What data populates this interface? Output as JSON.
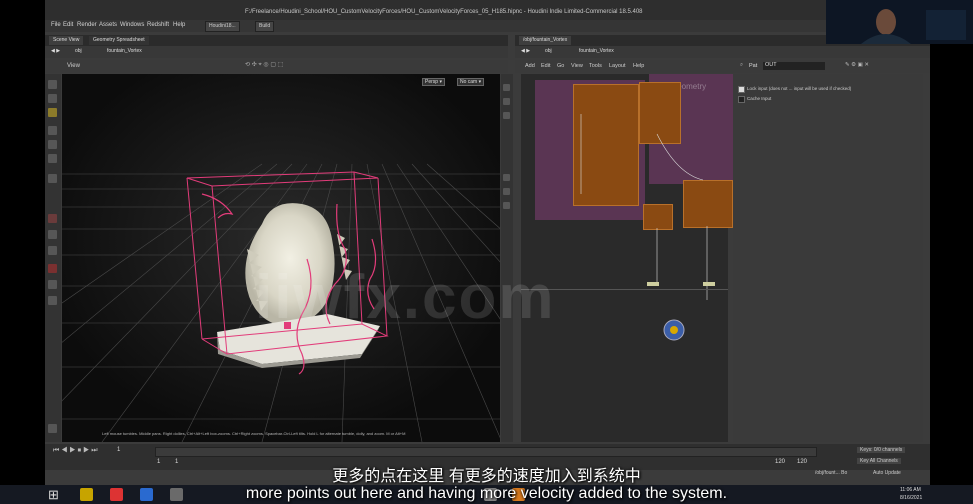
{
  "window": {
    "title": "F:/Freelance/Houdini_School/HOU_CustomVelocityForces/HOU_CustomVelocityForces_05_H185.hipnc - Houdini Indie Limited-Commercial 18.5.408"
  },
  "menu": [
    "File",
    "Edit",
    "Render",
    "Assets",
    "Windows",
    "Redshift",
    "Help"
  ],
  "desktop_bar": {
    "build_label": "Build",
    "desk_tab": "Houdini18..."
  },
  "left_pane": {
    "tabs": [
      "Scene View",
      "Geometry Spreadsheet"
    ],
    "path_obj": "obj",
    "path_node": "fountain_Vortex",
    "view_label": "View",
    "persp_label": "Persp ▾",
    "cam_label": "No cam ▾",
    "status_text": "Left mouse tumbles. Middle pans. Right dollies. Ctrl+Alt+Left box-zooms. Ctrl+Right zooms. Spacebar-Ctrl-Left tilts. Hold L for alternate tumble, dolly, and zoom.  M or Alt+M"
  },
  "right_pane": {
    "tab": "/obj/fountain_Vortex",
    "path_obj": "obj",
    "path_node": "fountain_Vortex",
    "menu": [
      "Add",
      "Edit",
      "Go",
      "View",
      "Tools",
      "Layout",
      "Help"
    ],
    "network_label": "Geometry",
    "params_search_label": "Pat",
    "params_search_value": "OUT",
    "params_options": [
      "Lock input (does not ... input will be used if checked)",
      "Cache Input"
    ]
  },
  "timeline": {
    "frame": "1",
    "start": "1",
    "end": "1",
    "range_end": "120",
    "range_end2": "120",
    "keys_label": "Keys: 0/0 channels",
    "channels_label": "Key All Channels",
    "render_label": "/obj/fount... Bo",
    "auto_update": "Auto Update"
  },
  "subtitles": {
    "cn": "更多的点在这里 有更多的速度加入到系统中",
    "en": "more points out here and having more velocity added to the system."
  },
  "watermark": "iiwfx.com",
  "taskbar": {
    "time": "11:06 AM",
    "date": "8/16/2021"
  }
}
